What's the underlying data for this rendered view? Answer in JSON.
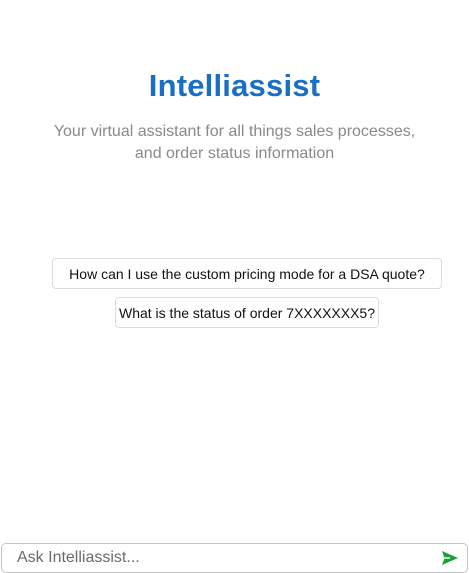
{
  "header": {
    "title": "Intelliassist",
    "subtitle_line1": "Your virtual assistant for all things sales processes,",
    "subtitle_line2": "and order status information"
  },
  "suggestions": [
    {
      "label": "How can I use the custom pricing mode for a DSA quote?"
    },
    {
      "label": "What is the status of order 7XXXXXXX5?"
    }
  ],
  "chat_input": {
    "placeholder": "Ask Intelliassist...",
    "value": "",
    "send_icon": "send-icon"
  },
  "colors": {
    "title": "#1a6fc4",
    "subtitle": "#8a8a8a",
    "send_icon": "#1e9e3a"
  }
}
